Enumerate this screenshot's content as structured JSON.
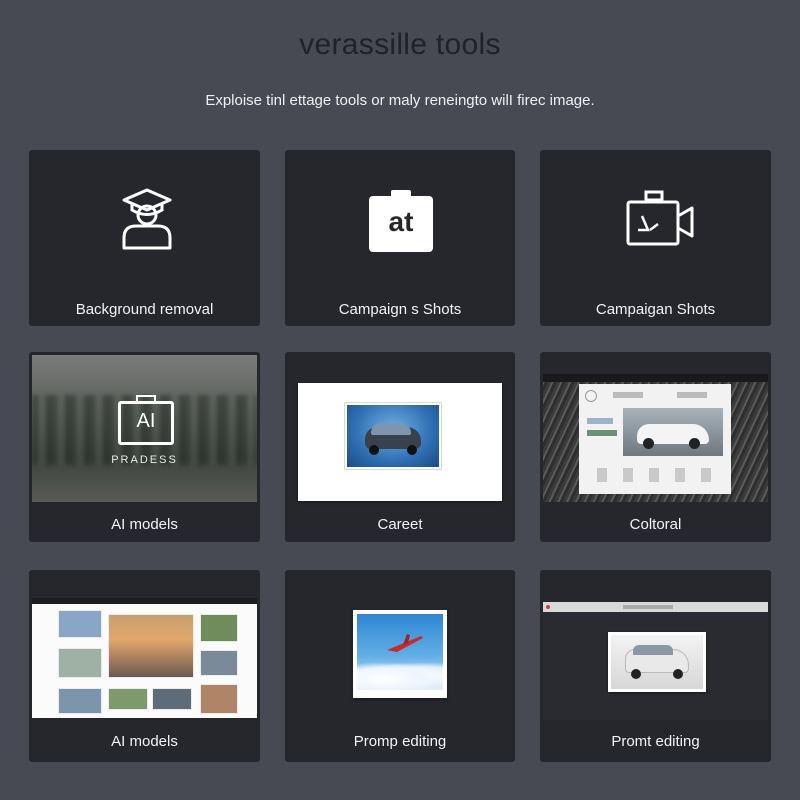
{
  "header": {
    "title": "verassille tools",
    "subtitle": "Exploise tinl ettage tools or maly reneingto wilI firec image."
  },
  "cards": [
    {
      "label": "Background removal",
      "icon": "person-graduate-icon"
    },
    {
      "label": "Campaign s Shots",
      "icon": "camera-icon",
      "icon_text": "at"
    },
    {
      "label": "Campaigan Shots",
      "icon": "video-camera-icon"
    },
    {
      "label": "AI models",
      "icon": "ai-camera-icon",
      "icon_text": "AI",
      "caption": "PRADESS"
    },
    {
      "label": "Careet",
      "icon": "car-photo-thumbnail"
    },
    {
      "label": "Coltoral",
      "icon": "car-editor-thumbnail"
    },
    {
      "label": "AI models",
      "icon": "photo-gallery-thumbnail"
    },
    {
      "label": "Promp editing",
      "icon": "airplane-photo-thumbnail"
    },
    {
      "label": "Promt editing",
      "icon": "suv-photo-thumbnail"
    }
  ],
  "colors": {
    "background": "#474a52",
    "card": "#25272c",
    "title": "#202227",
    "text": "#f3f3f5"
  }
}
